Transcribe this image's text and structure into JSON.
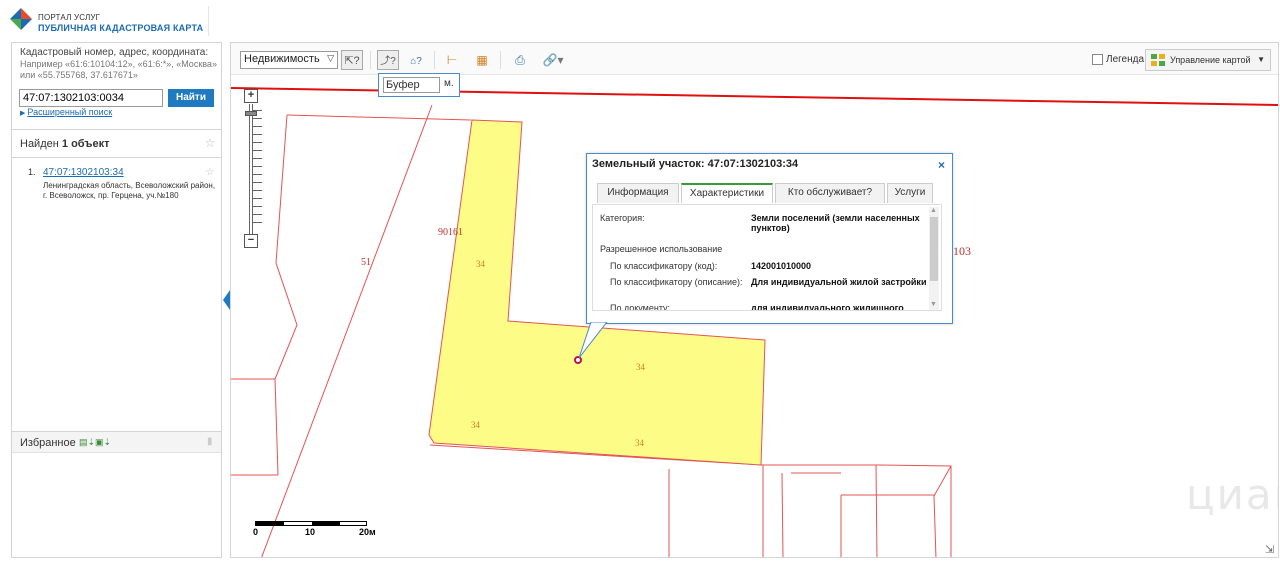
{
  "header": {
    "brand_line1": "ПОРТАЛ УСЛУГ",
    "brand_line2": "ПУБЛИЧНАЯ КАДАСТРОВАЯ КАРТА",
    "logo_icon": "portal-logo-icon"
  },
  "search": {
    "hint_title": "Кадастровый номер, адрес, координата:",
    "hint_example": "Например «61:6:10104:12», «61:6:*», «Москва» или «55.755768, 37.617671»",
    "input_value": "47:07:1302103:0034",
    "find_label": "Найти",
    "advanced_link": "Расширенный поиск"
  },
  "results": {
    "found_prefix": "Найден",
    "found_count": "1 объект",
    "items": [
      {
        "number": "1.",
        "cad_number": "47:07:1302103:34",
        "address": "Ленинградская область, Всеволожский район, г. Всеволожск, пр. Герцена, уч.№180"
      }
    ]
  },
  "favorites": {
    "label": "Избранное"
  },
  "toolbar": {
    "layer_select": "Недвижимость",
    "legend_label": "Легенда",
    "manage_label": "Управление картой",
    "buffer_placeholder": "Буфер",
    "buffer_unit": "м."
  },
  "map": {
    "labels": {
      "parcel_90161": "90161",
      "parcel_51": "51",
      "parcel_103": "103",
      "lbl_34_a": "34",
      "lbl_34_b": "34",
      "lbl_34_c": "34",
      "lbl_34_d": "34"
    },
    "colors": {
      "parcel_fill": "#fdfc86",
      "parcel_border": "#e35454",
      "boundary_red": "#e01010"
    },
    "scale": {
      "zero": "0",
      "mid": "10",
      "end": "20м"
    },
    "watermark": "циан"
  },
  "popup": {
    "title": "Земельный участок: 47:07:1302103:34",
    "tabs": [
      "Информация",
      "Характеристики",
      "Кто обслуживает?",
      "Услуги"
    ],
    "active_tab": "Характеристики",
    "rows": [
      {
        "label": "Категория:",
        "value": "Земли поселений (земли населенных пунктов)"
      },
      {
        "label": "Разрешенное использование",
        "value": ""
      },
      {
        "label": "По классификатору (код):",
        "value": "142001010000"
      },
      {
        "label": "По классификатору (описание):",
        "value": "Для индивидуальной жилой застройки"
      },
      {
        "label": "По документу:",
        "value": "для индивидуального жилищного"
      }
    ]
  }
}
